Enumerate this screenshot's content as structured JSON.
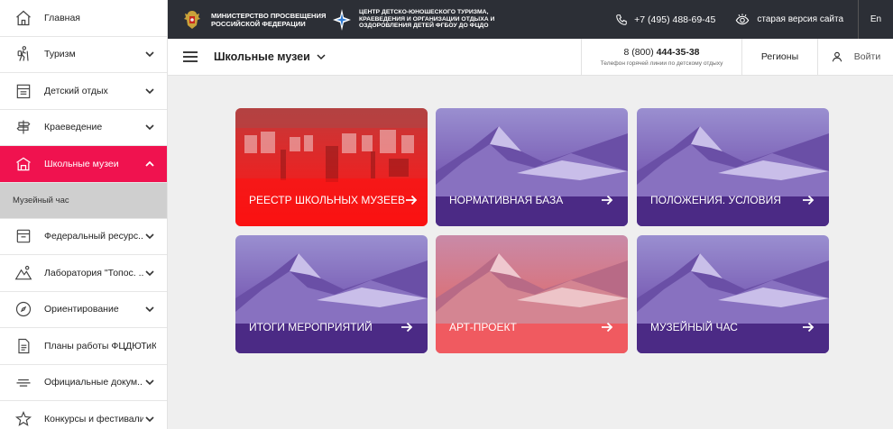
{
  "sidebar": {
    "items": [
      {
        "label": "Главная",
        "icon": "home-icon",
        "chevron": false
      },
      {
        "label": "Туризм",
        "icon": "hiker-icon",
        "chevron": true
      },
      {
        "label": "Детский отдых",
        "icon": "calendar-icon",
        "chevron": true
      },
      {
        "label": "Краеведение",
        "icon": "signpost-icon",
        "chevron": true
      },
      {
        "label": "Школьные музеи",
        "icon": "museum-icon",
        "chevron": true,
        "active": true
      },
      {
        "label": "Федеральный ресурс...",
        "icon": "folder-icon",
        "chevron": true
      },
      {
        "label": "Лаборатория \"Топос. ...",
        "icon": "mountain-icon",
        "chevron": true
      },
      {
        "label": "Ориентирование",
        "icon": "compass-icon",
        "chevron": true
      },
      {
        "label": "Планы работы ФЦДЮТиК",
        "icon": "document-icon",
        "chevron": false
      },
      {
        "label": "Официальные докум...",
        "icon": "lines-icon",
        "chevron": true
      },
      {
        "label": "Конкурсы и фестивали",
        "icon": "star-icon",
        "chevron": true
      }
    ],
    "sub_item": "Музейный час"
  },
  "topbar": {
    "ministry": "МИНИСТЕРСТВО ПРОСВЕЩЕНИЯ РОССИЙСКОЙ ФЕДЕРАЦИИ",
    "center": "ЦЕНТР ДЕТСКО-ЮНОШЕСКОГО ТУРИЗМА, КРАЕВЕДЕНИЯ И ОРГАНИЗАЦИИ ОТДЫХА И ОЗДОРОВЛЕНИЯ ДЕТЕЙ ФГБОУ ДО ФЦДО",
    "phone": "+7 (495) 488-69-45",
    "old_version": "старая версия сайта",
    "lang": "En"
  },
  "navbar": {
    "section": "Школьные музеи",
    "hotline_prefix": "8 (800) ",
    "hotline_bold": "444-35-38",
    "hotline_caption": "Телефон горячей линии по детскому отдыху",
    "regions": "Регионы",
    "login": "Войти"
  },
  "cards": [
    {
      "label": "РЕЕСТР ШКОЛЬНЫХ МУЗЕЕВ",
      "theme": "red-photo"
    },
    {
      "label": "НОРМАТИВНАЯ БАЗА",
      "theme": "purple"
    },
    {
      "label": "ПОЛОЖЕНИЯ. УСЛОВИЯ",
      "theme": "purple"
    },
    {
      "label": "ИТОГИ МЕРОПРИЯТИЙ",
      "theme": "purple"
    },
    {
      "label": "АРТ-ПРОЕКТ",
      "theme": "coral"
    },
    {
      "label": "МУЗЕЙНЫЙ ЧАС",
      "theme": "purple"
    }
  ],
  "colors": {
    "accent": "#f0124f",
    "topbar": "#2c2f36",
    "card_purple": "#4b2a85",
    "card_red": "#f01414",
    "card_coral": "#f05a60"
  }
}
